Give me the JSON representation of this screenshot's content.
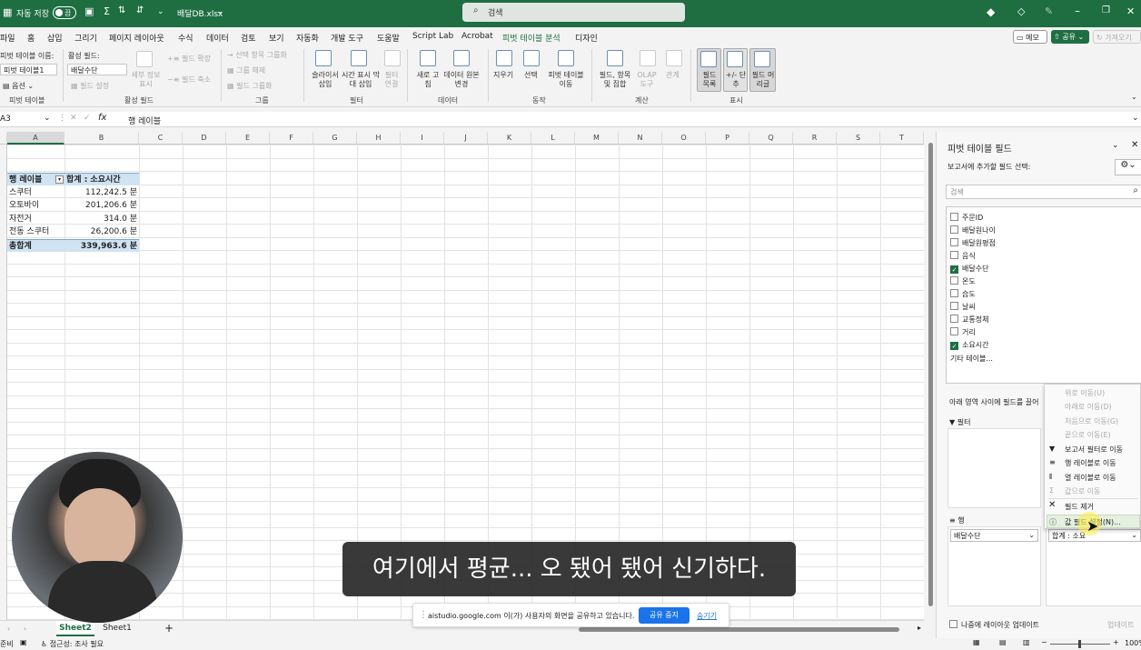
{
  "titlebar": {
    "autosave_label": "자동 저장",
    "autosave_state": "끔",
    "filename": "배달DB.xlsx",
    "search_placeholder": "검색"
  },
  "menu": [
    "파일",
    "홈",
    "삽입",
    "그리기",
    "페이지 레이아웃",
    "수식",
    "데이터",
    "검토",
    "보기",
    "자동화",
    "개발 도구",
    "도움말",
    "Script Lab",
    "Acrobat",
    "피벗 테이블 분석",
    "디자인"
  ],
  "menu_right": {
    "memo": "메모",
    "share": "공유",
    "take": "가져오기"
  },
  "ribbon": {
    "pivot_name_label": "피벗 테이블 이름:",
    "pivot_name_value": "피벗 테이블1",
    "options": "옵션",
    "group_pivot": "피벗 테이블",
    "active_field_label": "활성 필드:",
    "active_field_value": "배달수단",
    "field_settings": "필드 설정",
    "drill_down": "세부 정보 표시",
    "expand": "필드 확장",
    "collapse": "필드 축소",
    "group_active": "활성 필드",
    "group_sel": "선택 항목 그룹화",
    "ungroup": "그룹 해제",
    "group_field": "필드 그룹화",
    "group_group": "그룹",
    "slicer": "슬라이서 삽입",
    "timeline": "시간 표시 막대 삽입",
    "filter_conn": "필터 연결",
    "group_filter": "필터",
    "refresh": "새로 고침",
    "change_source": "데이터 원본 변경",
    "group_data": "데이터",
    "clear": "지우기",
    "select": "선택",
    "move": "피벗 테이블 이동",
    "group_action": "동작",
    "fields_items": "필드, 항목 및 집합",
    "olap": "OLAP 도구",
    "relations": "관계",
    "group_calc": "계산",
    "field_list": "필드 목록",
    "plus_minus": "+/- 단추",
    "field_headers": "필드 머리글",
    "group_show": "표시"
  },
  "formula": {
    "namebox": "A3",
    "fx": "fx",
    "content": "행 레이블"
  },
  "columns": [
    "A",
    "B",
    "C",
    "D",
    "E",
    "F",
    "G",
    "H",
    "I",
    "J",
    "K",
    "L",
    "M",
    "N",
    "O",
    "P",
    "Q",
    "R",
    "S",
    "T"
  ],
  "pivot": {
    "header_row": "행 레이블",
    "header_value": "합계 : 소요시간",
    "rows": [
      {
        "label": "스쿠터",
        "value": "112,242.5 분"
      },
      {
        "label": "오토바이",
        "value": "201,206.6 분"
      },
      {
        "label": "자전거",
        "value": "314.0 분"
      },
      {
        "label": "전동 스쿠터",
        "value": "26,200.6 분"
      }
    ],
    "total_label": "총합계",
    "total_value": "339,963.6 분"
  },
  "sheets": [
    "Sheet2",
    "Sheet1"
  ],
  "status": {
    "ready": "준비",
    "accessibility": "접근성: 조사 필요",
    "zoom": "100%"
  },
  "panel": {
    "title": "피벗 테이블 필드",
    "choose": "보고서에 추가할 필드 선택:",
    "search_placeholder": "검색",
    "fields": [
      {
        "name": "주문ID",
        "checked": false
      },
      {
        "name": "배달원나이",
        "checked": false
      },
      {
        "name": "배달원평점",
        "checked": false
      },
      {
        "name": "음식",
        "checked": false
      },
      {
        "name": "배달수단",
        "checked": true
      },
      {
        "name": "온도",
        "checked": false
      },
      {
        "name": "습도",
        "checked": false
      },
      {
        "name": "날씨",
        "checked": false
      },
      {
        "name": "교통정체",
        "checked": false
      },
      {
        "name": "거리",
        "checked": false
      },
      {
        "name": "소요시간",
        "checked": true
      }
    ],
    "more_tables": "기타 테이블...",
    "drag_label": "아래 영역 사이에 필드를 끌어",
    "filter_label": "필터",
    "rows_label": "행",
    "rows_value": "배달수단",
    "values_value": "합계 : 소요",
    "defer": "나중에 레이아웃 업데이트",
    "update": "업데이트"
  },
  "context_menu": {
    "items": [
      "위로 이동(U)",
      "아래로 이동(D)",
      "처음으로 이동(G)",
      "끝으로 이동(E)",
      "보고서 필터로 이동",
      "행 레이블로 이동",
      "열 레이블로 이동",
      "값으로 이동",
      "필드 제거",
      "값 필드 설정(N)..."
    ]
  },
  "subtitle": "여기에서 평균... 오 됐어 됐어 신기하다.",
  "share_bar": {
    "message": "aistudio.google.com 이(가) 사용자의 화면을 공유하고 있습니다.",
    "stop": "공유 중지",
    "hide": "숨기기"
  }
}
